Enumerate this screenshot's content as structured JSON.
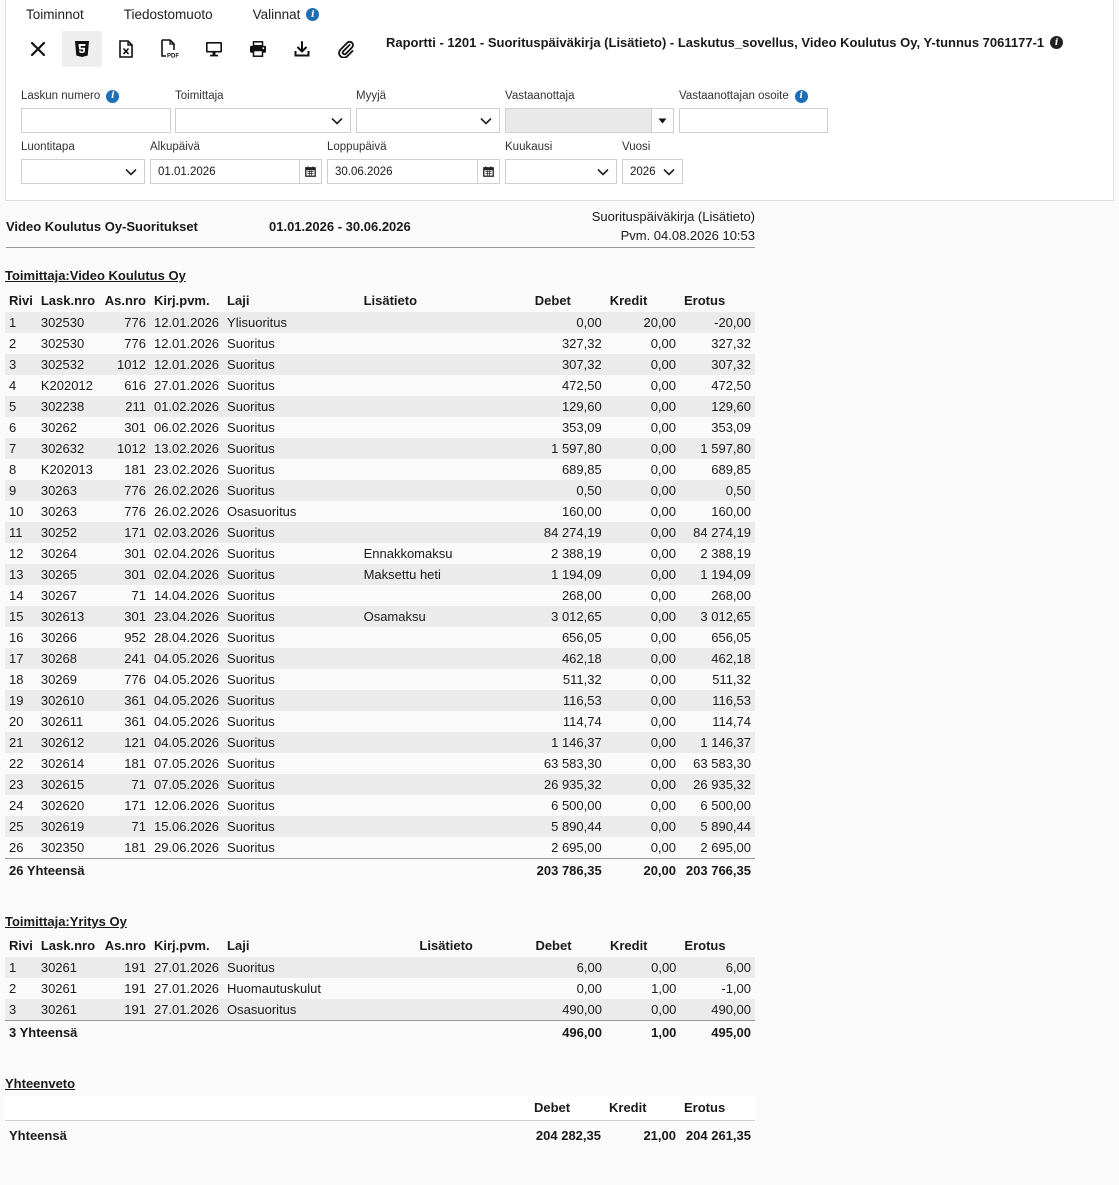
{
  "menu": {
    "items": [
      "Toiminnot",
      "Tiedostomuoto",
      "Valinnat"
    ]
  },
  "toolbar": {
    "icons": [
      "close-icon",
      "html5-icon",
      "excel-icon",
      "pdf-icon",
      "monitor-icon",
      "print-icon",
      "download-icon",
      "attachment-icon"
    ]
  },
  "report_title": "Raportti - 1201 - Suorituspäiväkirja (Lisätieto) - Laskutus_sovellus, Video Koulutus Oy, Y-tunnus 7061177-1",
  "filters": {
    "laskun_numero": {
      "label": "Laskun numero",
      "value": ""
    },
    "toimittaja": {
      "label": "Toimittaja",
      "value": ""
    },
    "myyja": {
      "label": "Myyjä",
      "value": ""
    },
    "vastaanottaja": {
      "label": "Vastaanottaja",
      "value": ""
    },
    "vastaanottajan_osoite": {
      "label": "Vastaanottajan osoite",
      "value": ""
    },
    "luontitapa": {
      "label": "Luontitapa",
      "value": ""
    },
    "alkupaiva": {
      "label": "Alkupäivä",
      "value": "01.01.2026"
    },
    "loppupaiva": {
      "label": "Loppupäivä",
      "value": "30.06.2026"
    },
    "kuukausi": {
      "label": "Kuukausi",
      "value": ""
    },
    "vuosi": {
      "label": "Vuosi",
      "value": "2026"
    }
  },
  "report": {
    "company": "Video Koulutus Oy-Suoritukset",
    "period_start": "01.01.2026",
    "period_sep": "-",
    "period_end": "30.06.2026",
    "report_type": "Suorituspäiväkirja (Lisätieto)",
    "report_date": "Pvm. 04.08.2026 10:53"
  },
  "columns": [
    "Rivi",
    "Lask.nro",
    "As.nro",
    "Kirj.pvm.",
    "Laji",
    "Lisätieto",
    "Debet",
    "Kredit",
    "Erotus"
  ],
  "sections": [
    {
      "title": "Toimittaja:Video Koulutus Oy",
      "rows": [
        [
          "1",
          "302530",
          "776",
          "12.01.2026",
          "Ylisuoritus",
          "",
          "0,00",
          "20,00",
          "-20,00"
        ],
        [
          "2",
          "302530",
          "776",
          "12.01.2026",
          "Suoritus",
          "",
          "327,32",
          "0,00",
          "327,32"
        ],
        [
          "3",
          "302532",
          "1012",
          "12.01.2026",
          "Suoritus",
          "",
          "307,32",
          "0,00",
          "307,32"
        ],
        [
          "4",
          "K202012",
          "616",
          "27.01.2026",
          "Suoritus",
          "",
          "472,50",
          "0,00",
          "472,50"
        ],
        [
          "5",
          "302238",
          "211",
          "01.02.2026",
          "Suoritus",
          "",
          "129,60",
          "0,00",
          "129,60"
        ],
        [
          "6",
          "30262",
          "301",
          "06.02.2026",
          "Suoritus",
          "",
          "353,09",
          "0,00",
          "353,09"
        ],
        [
          "7",
          "302632",
          "1012",
          "13.02.2026",
          "Suoritus",
          "",
          "1 597,80",
          "0,00",
          "1 597,80"
        ],
        [
          "8",
          "K202013",
          "181",
          "23.02.2026",
          "Suoritus",
          "",
          "689,85",
          "0,00",
          "689,85"
        ],
        [
          "9",
          "30263",
          "776",
          "26.02.2026",
          "Suoritus",
          "",
          "0,50",
          "0,00",
          "0,50"
        ],
        [
          "10",
          "30263",
          "776",
          "26.02.2026",
          "Osasuoritus",
          "",
          "160,00",
          "0,00",
          "160,00"
        ],
        [
          "11",
          "30252",
          "171",
          "02.03.2026",
          "Suoritus",
          "",
          "84 274,19",
          "0,00",
          "84 274,19"
        ],
        [
          "12",
          "30264",
          "301",
          "02.04.2026",
          "Suoritus",
          "Ennakkomaksu",
          "2 388,19",
          "0,00",
          "2 388,19"
        ],
        [
          "13",
          "30265",
          "301",
          "02.04.2026",
          "Suoritus",
          "Maksettu heti",
          "1 194,09",
          "0,00",
          "1 194,09"
        ],
        [
          "14",
          "30267",
          "71",
          "14.04.2026",
          "Suoritus",
          "",
          "268,00",
          "0,00",
          "268,00"
        ],
        [
          "15",
          "302613",
          "301",
          "23.04.2026",
          "Suoritus",
          "Osamaksu",
          "3 012,65",
          "0,00",
          "3 012,65"
        ],
        [
          "16",
          "30266",
          "952",
          "28.04.2026",
          "Suoritus",
          "",
          "656,05",
          "0,00",
          "656,05"
        ],
        [
          "17",
          "30268",
          "241",
          "04.05.2026",
          "Suoritus",
          "",
          "462,18",
          "0,00",
          "462,18"
        ],
        [
          "18",
          "30269",
          "776",
          "04.05.2026",
          "Suoritus",
          "",
          "511,32",
          "0,00",
          "511,32"
        ],
        [
          "19",
          "302610",
          "361",
          "04.05.2026",
          "Suoritus",
          "",
          "116,53",
          "0,00",
          "116,53"
        ],
        [
          "20",
          "302611",
          "361",
          "04.05.2026",
          "Suoritus",
          "",
          "114,74",
          "0,00",
          "114,74"
        ],
        [
          "21",
          "302612",
          "121",
          "04.05.2026",
          "Suoritus",
          "",
          "1 146,37",
          "0,00",
          "1 146,37"
        ],
        [
          "22",
          "302614",
          "181",
          "07.05.2026",
          "Suoritus",
          "",
          "63 583,30",
          "0,00",
          "63 583,30"
        ],
        [
          "23",
          "302615",
          "71",
          "07.05.2026",
          "Suoritus",
          "",
          "26 935,32",
          "0,00",
          "26 935,32"
        ],
        [
          "24",
          "302620",
          "171",
          "12.06.2026",
          "Suoritus",
          "",
          "6 500,00",
          "0,00",
          "6 500,00"
        ],
        [
          "25",
          "302619",
          "71",
          "15.06.2026",
          "Suoritus",
          "",
          "5 890,44",
          "0,00",
          "5 890,44"
        ],
        [
          "26",
          "302350",
          "181",
          "29.06.2026",
          "Suoritus",
          "",
          "2 695,00",
          "0,00",
          "2 695,00"
        ]
      ],
      "total": {
        "label": "26 Yhteensä",
        "debet": "203 786,35",
        "kredit": "20,00",
        "erotus": "203 766,35"
      }
    },
    {
      "title": "Toimittaja:Yritys Oy",
      "rows": [
        [
          "1",
          "30261",
          "191",
          "27.01.2026",
          "Suoritus",
          "",
          "6,00",
          "0,00",
          "6,00"
        ],
        [
          "2",
          "30261",
          "191",
          "27.01.2026",
          "Huomautuskulut",
          "",
          "0,00",
          "1,00",
          "-1,00"
        ],
        [
          "3",
          "30261",
          "191",
          "27.01.2026",
          "Osasuoritus",
          "",
          "490,00",
          "0,00",
          "490,00"
        ]
      ],
      "total": {
        "label": "3 Yhteensä",
        "debet": "496,00",
        "kredit": "1,00",
        "erotus": "495,00"
      }
    }
  ],
  "summary": {
    "title": "Yhteenveto",
    "label": "Yhteensä",
    "debet": "204 282,35",
    "kredit": "21,00",
    "erotus": "204 261,35"
  },
  "colors": {
    "info": "#1e6fb8",
    "stripe": "#ebebeb"
  }
}
